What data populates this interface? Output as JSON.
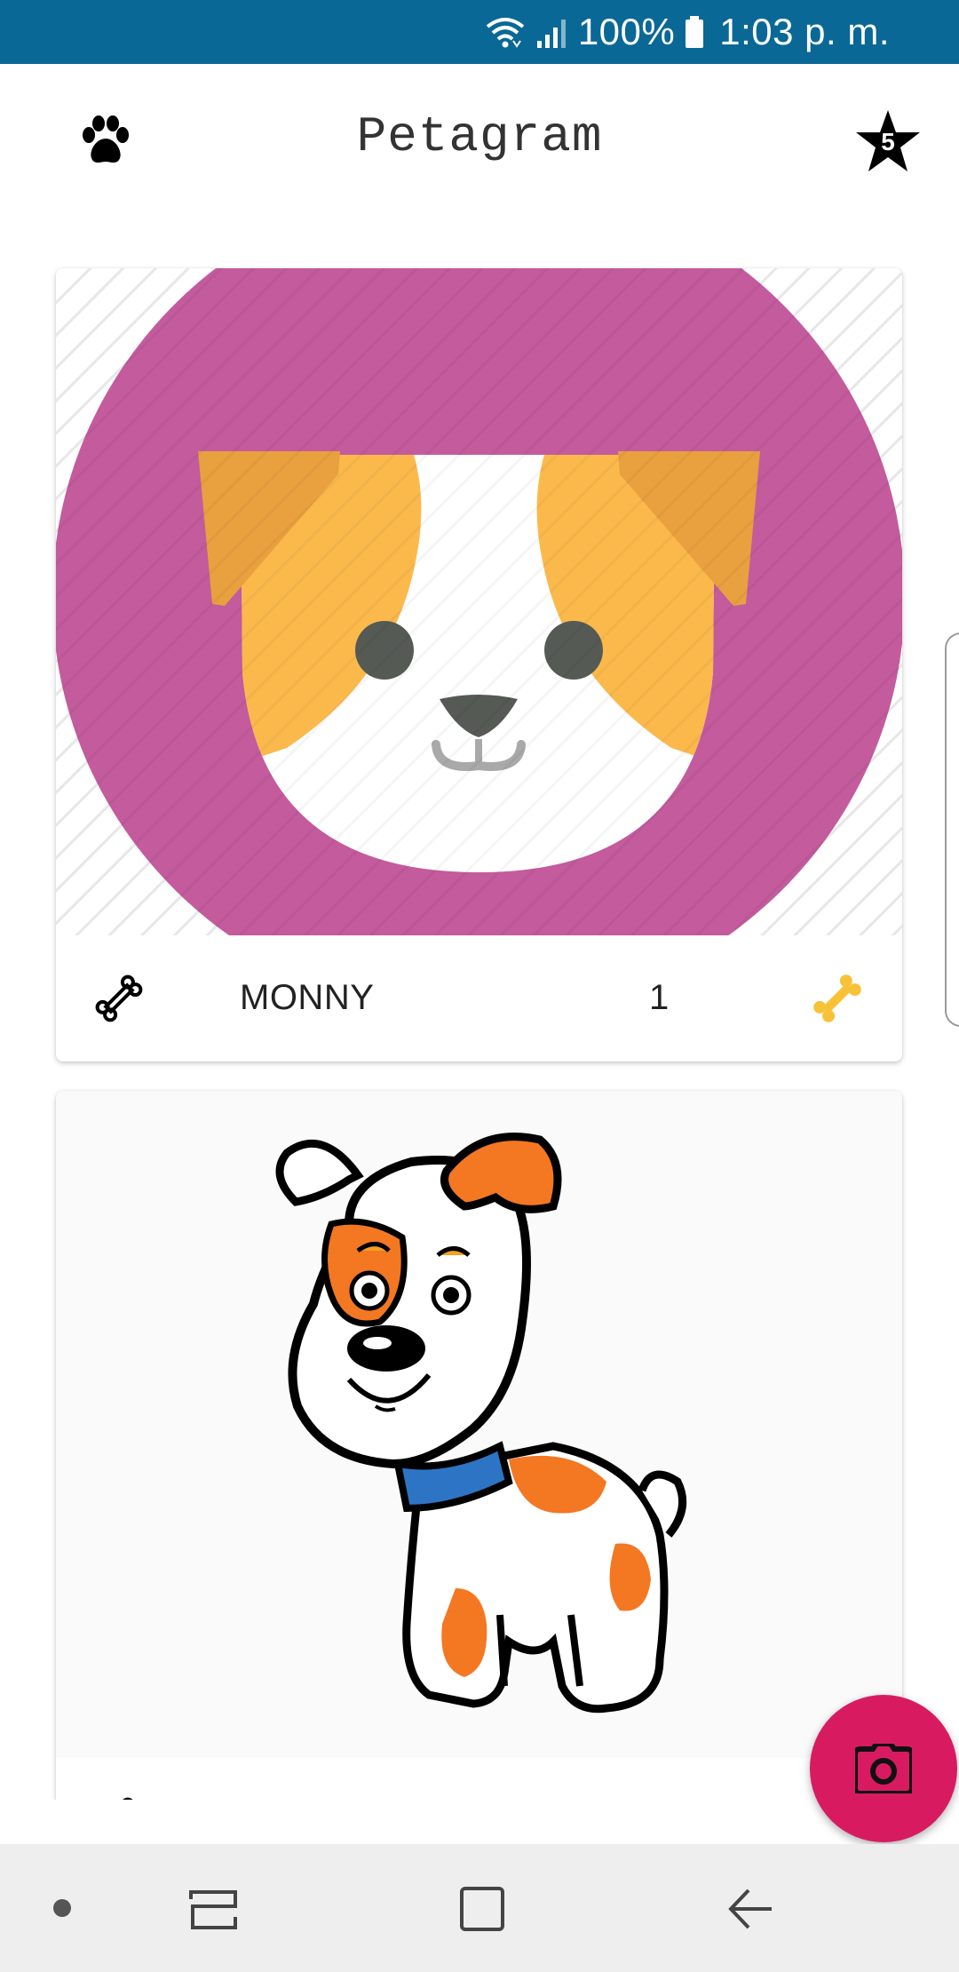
{
  "status_bar": {
    "battery": "100%",
    "time": "1:03 p. m.",
    "icons": [
      "wifi-icon",
      "signal-icon",
      "battery-icon"
    ],
    "background": "#0a6896"
  },
  "app_bar": {
    "title": "Petagram",
    "left_icon": "paw-icon",
    "right_icon": "star-icon",
    "star_badge": "5"
  },
  "pets": [
    {
      "name": "MONNY",
      "likes": "1",
      "image": "puppy-face-illustration",
      "action_icon": "bone-outline-icon",
      "rating_icon": "bone-yellow-icon"
    },
    {
      "name": "",
      "likes": "",
      "image": "cartoon-dog-illustration",
      "action_icon": "bone-outline-icon",
      "rating_icon": "bone-yellow-icon"
    }
  ],
  "fab": {
    "icon": "camera-icon",
    "color": "#d81b60"
  },
  "nav_bar": {
    "buttons": [
      "nav-dot",
      "recents-icon",
      "home-icon",
      "back-icon"
    ]
  },
  "colors": {
    "accent": "#d81b60",
    "primary_dark": "#0a6896",
    "pet_bg": "#c35b9c",
    "bone_yellow": "#f7c238"
  }
}
